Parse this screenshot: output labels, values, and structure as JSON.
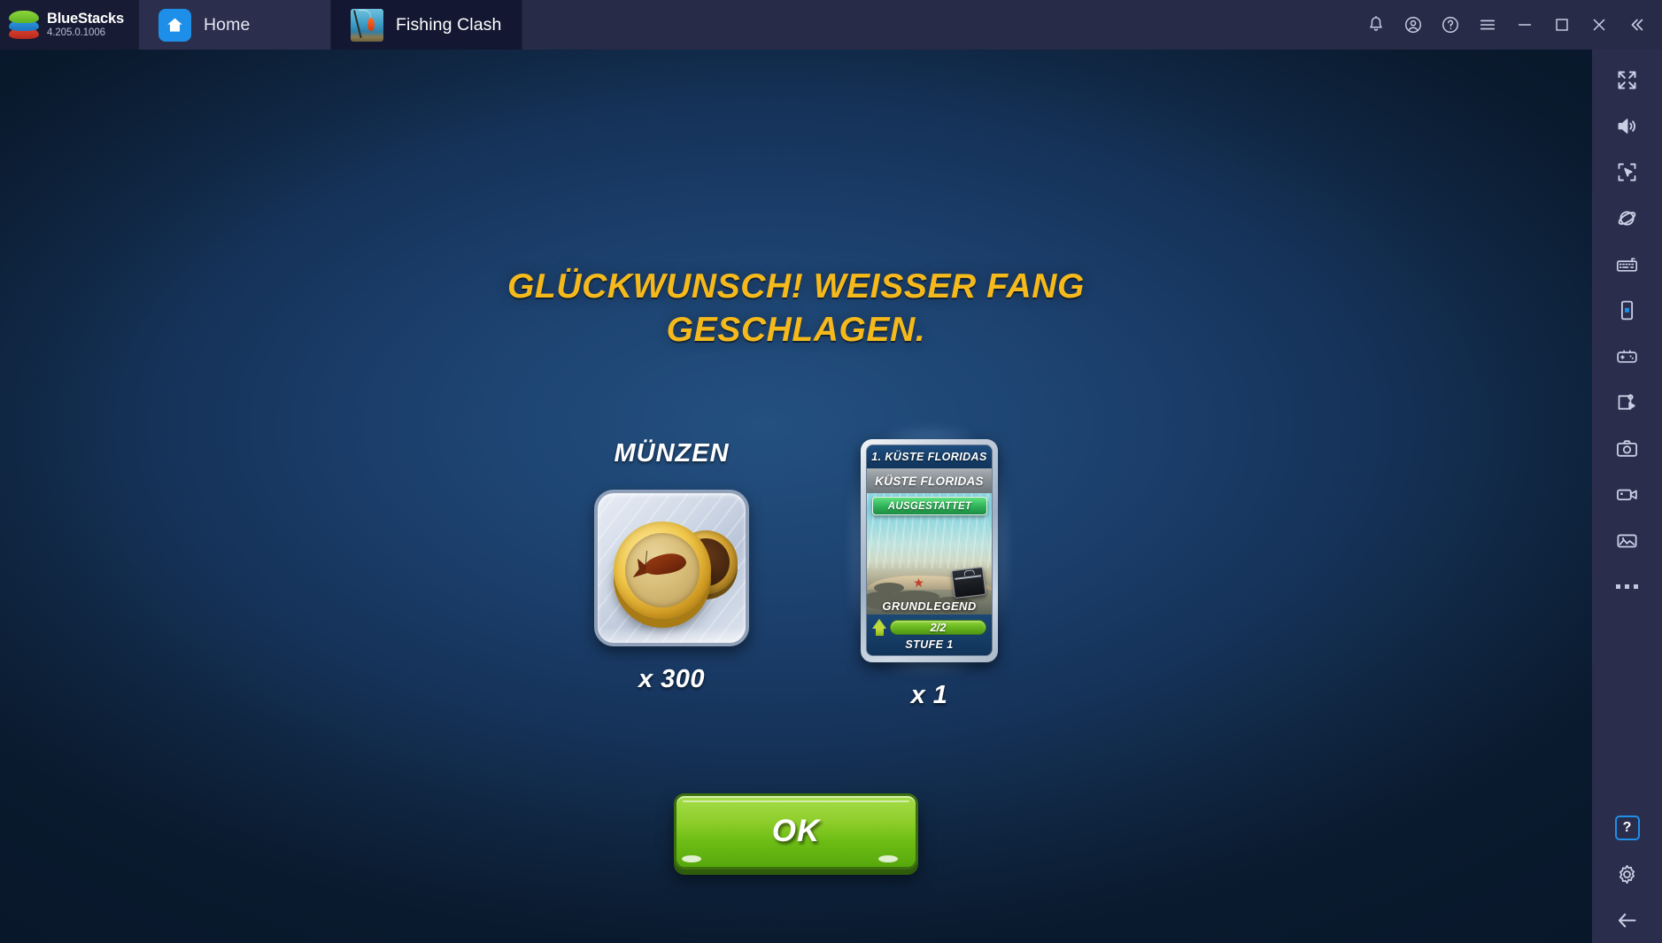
{
  "titlebar": {
    "brand_name": "BlueStacks",
    "version": "4.205.0.1006",
    "tabs": [
      {
        "label": "Home",
        "icon": "home-icon",
        "active": false
      },
      {
        "label": "Fishing Clash",
        "icon": "fishing-clash-icon",
        "active": true
      }
    ],
    "actions": [
      {
        "name": "notifications-icon",
        "label": "Notifications"
      },
      {
        "name": "account-icon",
        "label": "Account"
      },
      {
        "name": "help-icon",
        "label": "Help"
      },
      {
        "name": "menu-icon",
        "label": "Menu"
      },
      {
        "name": "minimize-icon",
        "label": "Minimize"
      },
      {
        "name": "maximize-icon",
        "label": "Maximize"
      },
      {
        "name": "close-icon",
        "label": "Close"
      },
      {
        "name": "collapse-icon",
        "label": "Collapse sidebar"
      }
    ]
  },
  "sidebar": {
    "items": [
      {
        "name": "fullscreen-icon",
        "label": "Fullscreen"
      },
      {
        "name": "volume-icon",
        "label": "Volume"
      },
      {
        "name": "multi-point-click-icon",
        "label": "Multi-point click"
      },
      {
        "name": "eco-mode-icon",
        "label": "Eco mode"
      },
      {
        "name": "keyboard-controls-icon",
        "label": "Game controls"
      },
      {
        "name": "rotate-screen-icon",
        "label": "Rotate"
      },
      {
        "name": "gamepad-icon",
        "label": "Gamepad"
      },
      {
        "name": "macro-recorder-icon",
        "label": "Macro recorder"
      },
      {
        "name": "screenshot-icon",
        "label": "Screenshot"
      },
      {
        "name": "record-video-icon",
        "label": "Record"
      },
      {
        "name": "media-manager-icon",
        "label": "Media manager"
      },
      {
        "name": "more-options-icon",
        "label": "More"
      }
    ],
    "bottom_items": [
      {
        "name": "help-box-icon",
        "label": "?"
      },
      {
        "name": "settings-gear-icon",
        "label": "Settings"
      },
      {
        "name": "back-arrow-icon",
        "label": "Back"
      }
    ]
  },
  "game": {
    "headline_line1": "GLÜCKWUNSCH! WEISSER FANG",
    "headline_line2": "GESCHLAGEN.",
    "rewards": [
      {
        "title": "MÜNZEN",
        "quantity": "x 300",
        "icon": "gold-coins-icon"
      },
      {
        "title": "",
        "quantity": "x 1",
        "card": {
          "rank": "1. KÜSTE FLORIDAS",
          "name": "KÜSTE FLORIDAS",
          "status_badge": "AUSGESTATTET",
          "tier": "GRUNDLEGEND",
          "progress_text": "2/2",
          "progress_current": 2,
          "progress_max": 2,
          "level": "STUFE 1"
        }
      }
    ],
    "ok_button": "OK"
  },
  "colors": {
    "headline_gold": "#f5b91c",
    "ok_green": "#7fc424",
    "badge_green": "#2fb35a",
    "accent_blue": "#1e8fe8",
    "titlebar_bg": "#272b47",
    "sidebar_bg": "#2a2e4c",
    "game_bg_center": "#23507f",
    "game_bg_edge": "#0b1d33"
  }
}
